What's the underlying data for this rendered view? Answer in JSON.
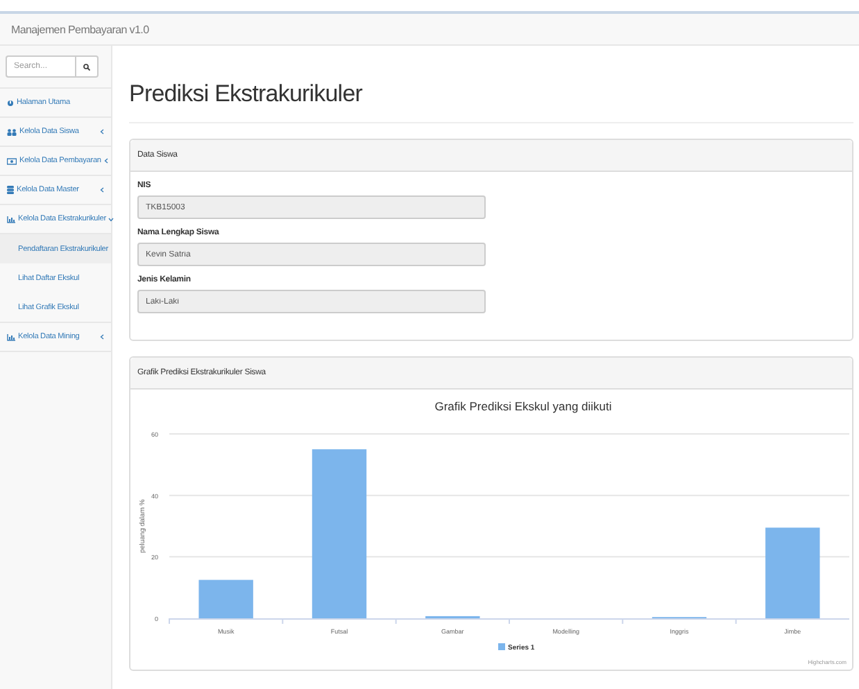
{
  "app": {
    "title": "Manajemen Pembayaran v1.0"
  },
  "sidebar": {
    "search": {
      "placeholder": "Search..."
    },
    "items": [
      {
        "label": "Halaman Utama",
        "selected": false
      },
      {
        "label": "Kelola Data Siswa",
        "expanded": false,
        "selected": false
      },
      {
        "label": "Kelola Data Pembayaran",
        "expanded": false,
        "selected": false
      },
      {
        "label": "Kelola Data Master",
        "expanded": false,
        "selected": false
      },
      {
        "label": "Kelola Data Ekstrakurikuler",
        "expanded": true,
        "selected": false,
        "children": [
          {
            "label": "Pendaftaran Ekstrakurikuler",
            "selected": true
          },
          {
            "label": "Lihat Daftar Ekskul",
            "selected": false
          },
          {
            "label": "Lihat Grafik Ekskul",
            "selected": false
          }
        ]
      },
      {
        "label": "Kelola Data Mining",
        "expanded": false,
        "selected": false
      }
    ]
  },
  "page": {
    "title": "Prediksi Ekstrakurikuler"
  },
  "student_panel": {
    "heading": "Data Siswa",
    "fields": [
      {
        "label": "NIS",
        "value": "TKB15003",
        "disabled": true
      },
      {
        "label": "Nama Lengkap Siswa",
        "value": "Kevin Satria",
        "disabled": true
      },
      {
        "label": "Jenis Kelamin",
        "value": "Laki-Laki",
        "disabled": true
      }
    ]
  },
  "chart_panel": {
    "heading": "Grafik Prediksi Ekstrakurikuler Siswa",
    "credit": "Highcharts.com",
    "chart_data": {
      "type": "bar",
      "orientation": "vertical",
      "title": "Grafik Prediksi Ekskul yang diikuti",
      "ylabel": "peluang dalam %",
      "categories": [
        "Musik",
        "Futsal",
        "Gambar",
        "Modelling",
        "Inggris",
        "Jimbe"
      ],
      "series": [
        {
          "name": "Series 1",
          "color": "#7cb5ec",
          "values": [
            12.5,
            55,
            0.7,
            0,
            0.4,
            29.5
          ]
        }
      ],
      "ylim": [
        0,
        60
      ],
      "yticks": [
        0,
        20,
        40,
        60
      ]
    }
  }
}
